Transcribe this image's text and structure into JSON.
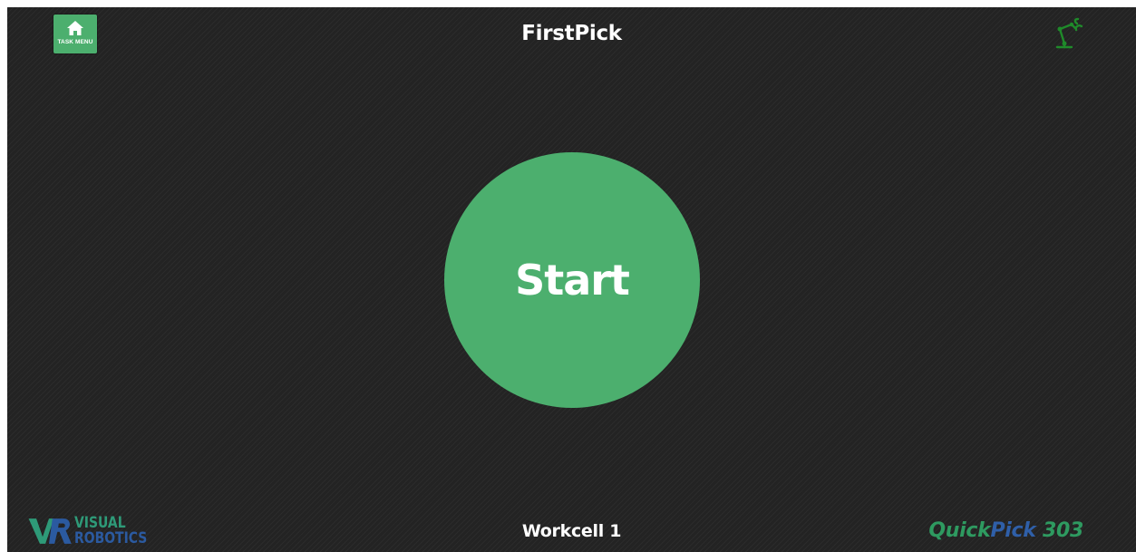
{
  "header": {
    "task_menu_label": "TASK MENU",
    "task_menu_icon": "home-icon",
    "title": "FirstPick",
    "robot_icon": "robot-arm-icon"
  },
  "main": {
    "start_label": "Start"
  },
  "footer": {
    "workcell": "Workcell 1",
    "logo_text_line1": "VISUAL",
    "logo_text_line2": "ROBOTICS",
    "logo_mark": "VR",
    "product_part1": "Quick",
    "product_part2": "Pick",
    "product_part3": " 303"
  },
  "colors": {
    "background": "#232323",
    "accent_green": "#4caf6e",
    "brand_green": "#2e9a60",
    "brand_blue": "#2f5fa8",
    "robot_icon_green": "#1f8a2a"
  }
}
